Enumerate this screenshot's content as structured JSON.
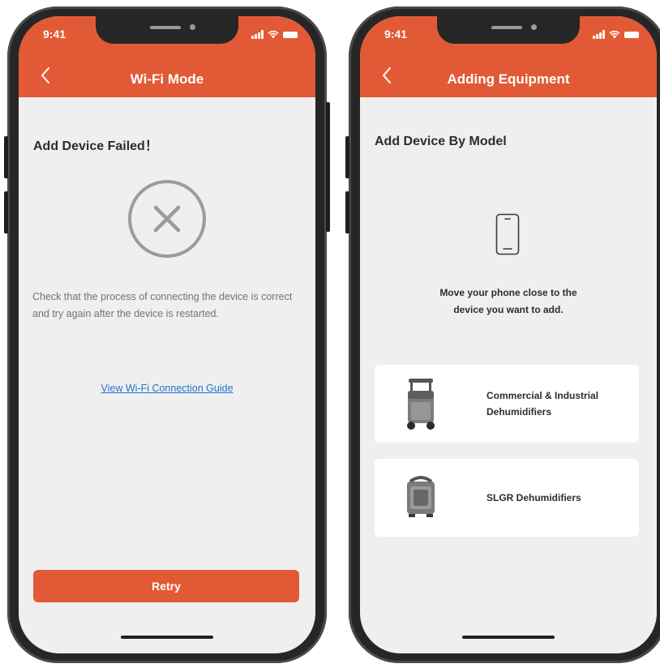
{
  "status_bar": {
    "time": "9:41"
  },
  "left_screen": {
    "nav_title": "Wi-Fi Mode",
    "section_title": "Add Device Failed！",
    "failure_message": "Check that the process of connecting the device is correct and try again after the device is restarted.",
    "guide_link": "View Wi-Fi Connection Guide",
    "retry_label": "Retry"
  },
  "right_screen": {
    "nav_title": "Adding Equipment",
    "section_title": "Add Device By Model",
    "hint_line1": "Move your phone close to the",
    "hint_line2": "device you want to add.",
    "models": [
      {
        "label": "Commercial & Industrial Dehumidifiers",
        "icon": "dehumidifier-tall-icon"
      },
      {
        "label": "SLGR Dehumidifiers",
        "icon": "dehumidifier-compact-icon"
      }
    ]
  },
  "colors": {
    "accent": "#e25a35",
    "screen_bg": "#efefef",
    "link": "#1f74c9",
    "frame": "#262626"
  }
}
